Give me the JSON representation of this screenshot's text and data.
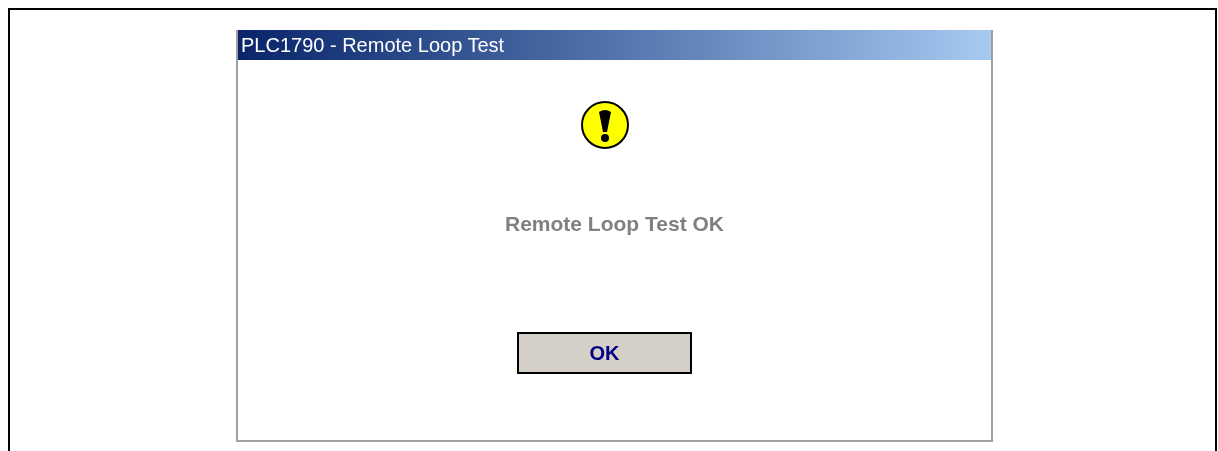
{
  "window": {
    "title": "PLC1790 - Remote Loop Test"
  },
  "message": "Remote Loop Test OK",
  "buttons": [
    "OK"
  ]
}
